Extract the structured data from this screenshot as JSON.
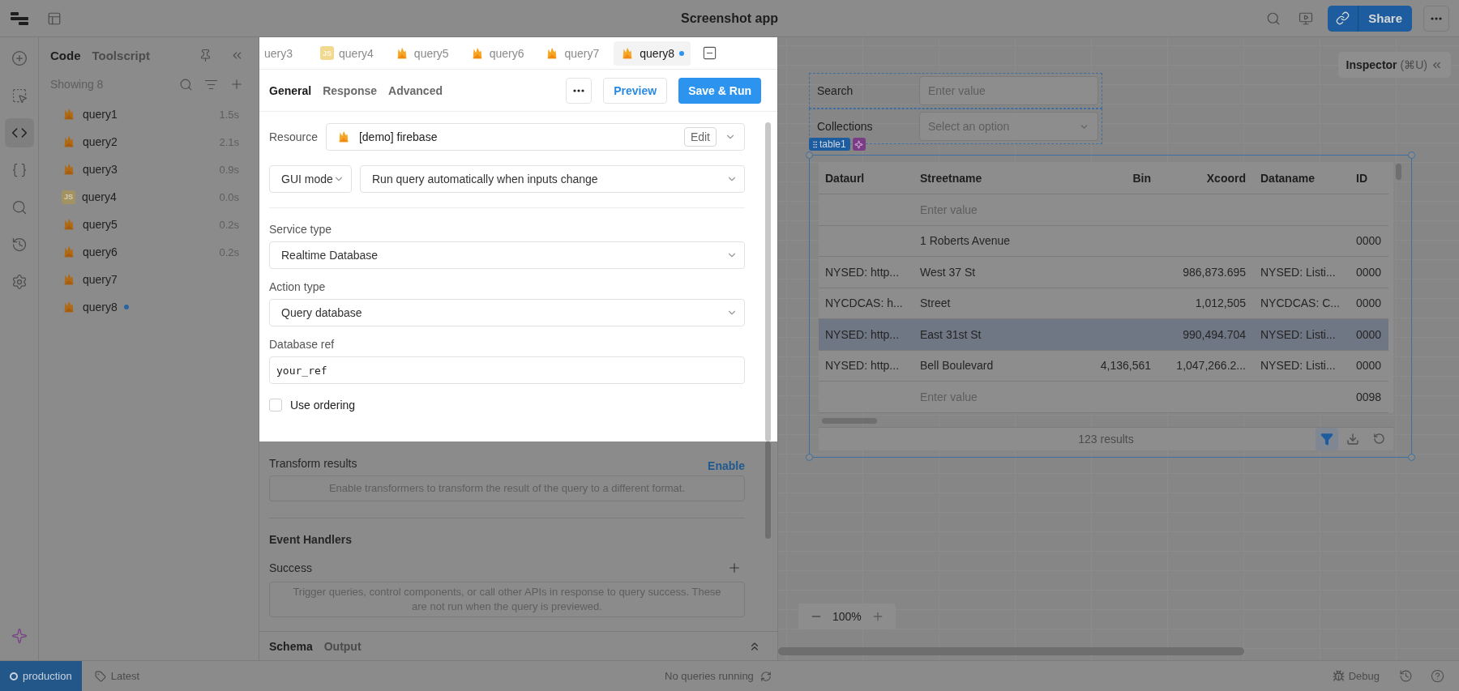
{
  "app": {
    "title": "Screenshot app",
    "share": "Share"
  },
  "sidebar": {
    "tabs": [
      {
        "label": "Code",
        "selected": true
      },
      {
        "label": "Toolscript",
        "selected": false
      }
    ],
    "count": "Showing 8",
    "queries": [
      {
        "name": "query1",
        "kind": "firebase",
        "time": "1.5s",
        "unsaved": false
      },
      {
        "name": "query2",
        "kind": "firebase",
        "time": "2.1s",
        "unsaved": false
      },
      {
        "name": "query3",
        "kind": "firebase",
        "time": "0.9s",
        "unsaved": false
      },
      {
        "name": "query4",
        "kind": "js",
        "badge": "JS",
        "time": "0.0s",
        "unsaved": false
      },
      {
        "name": "query5",
        "kind": "firebase",
        "time": "0.2s",
        "unsaved": false
      },
      {
        "name": "query6",
        "kind": "firebase",
        "time": "0.2s",
        "unsaved": false
      },
      {
        "name": "query7",
        "kind": "firebase",
        "unsaved": false
      },
      {
        "name": "query8",
        "kind": "firebase",
        "unsaved": true
      }
    ]
  },
  "editor": {
    "tabs": [
      {
        "label": "uery3",
        "kind": "cut",
        "selected": false,
        "unsaved": false
      },
      {
        "label": "query4",
        "kind": "js",
        "badge": "JS",
        "selected": false,
        "unsaved": false
      },
      {
        "label": "query5",
        "kind": "firebase",
        "selected": false,
        "unsaved": false
      },
      {
        "label": "query6",
        "kind": "firebase",
        "selected": false,
        "unsaved": false
      },
      {
        "label": "query7",
        "kind": "firebase",
        "selected": false,
        "unsaved": false
      },
      {
        "label": "query8",
        "kind": "firebase",
        "selected": true,
        "unsaved": true
      }
    ],
    "sections": [
      {
        "label": "General",
        "selected": true
      },
      {
        "label": "Response",
        "selected": false
      },
      {
        "label": "Advanced",
        "selected": false
      }
    ],
    "preview": "Preview",
    "save": "Save & Run",
    "resource": {
      "label": "Resource",
      "value": "[demo] firebase",
      "edit": "Edit"
    },
    "mode": "GUI mode",
    "trigger": "Run query automatically when inputs change",
    "fields": [
      {
        "label": "Service type",
        "kind": "select",
        "value": "Realtime Database"
      },
      {
        "label": "Action type",
        "kind": "select",
        "value": "Query database"
      },
      {
        "label": "Database ref",
        "kind": "code",
        "value": "your_ref"
      }
    ],
    "ordering": {
      "label": "Use ordering",
      "checked": false
    },
    "transform": {
      "title": "Transform results",
      "action": "Enable",
      "hint": "Enable transformers to transform the result of the query to a different format."
    },
    "events": {
      "title": "Event Handlers",
      "success": "Success",
      "hint": "Trigger queries, control components, or call other APIs in response to query success. These are not run when the query is previewed."
    },
    "bottom_tabs": [
      {
        "label": "Schema",
        "selected": true
      },
      {
        "label": "Output",
        "selected": false
      }
    ]
  },
  "canvas": {
    "inspector": "Inspector",
    "shortcut": "(⌘U)",
    "form": [
      {
        "label": "Search",
        "kind": "input",
        "placeholder": "Enter value"
      },
      {
        "label": "Collections",
        "kind": "select",
        "placeholder": "Select an option"
      }
    ],
    "table": {
      "name": "table1",
      "columns": [
        {
          "label": "Dataurl",
          "kind": "text"
        },
        {
          "label": "Streetname",
          "kind": "text"
        },
        {
          "label": "Bin",
          "kind": "number"
        },
        {
          "label": "Xcoord",
          "kind": "number"
        },
        {
          "label": "Dataname",
          "kind": "text"
        },
        {
          "label": "ID",
          "kind": "text"
        }
      ],
      "rows": [
        {
          "selected": false,
          "cells": [
            null,
            {
              "placeholder": "Enter value"
            },
            null,
            null,
            null,
            null
          ]
        },
        {
          "selected": false,
          "cells": [
            null,
            "1 Roberts Avenue",
            null,
            null,
            null,
            "0000"
          ]
        },
        {
          "selected": false,
          "cells": [
            "NYSED: http...",
            "West 37 St",
            null,
            "986,873.695",
            "NYSED: Listi...",
            "0000"
          ]
        },
        {
          "selected": false,
          "cells": [
            "NYCDCAS: h...",
            "Street",
            null,
            "1,012,505",
            "NYCDCAS: C...",
            "0000"
          ]
        },
        {
          "selected": true,
          "cells": [
            "NYSED: http...",
            "East 31st St",
            null,
            "990,494.704",
            "NYSED: Listi...",
            "0000"
          ]
        },
        {
          "selected": false,
          "cells": [
            "NYSED: http...",
            "Bell Boulevard",
            "4,136,561",
            "1,047,266.2...",
            "NYSED: Listi...",
            "0000"
          ]
        },
        {
          "selected": false,
          "cells": [
            null,
            {
              "placeholder": "Enter value"
            },
            null,
            null,
            null,
            "0098"
          ]
        }
      ],
      "footer": "123 results",
      "filter_on": true
    },
    "zoom": "100%"
  },
  "status_bar": {
    "environment": "production",
    "version": "Latest",
    "running": "No queries running",
    "debug": "Debug"
  }
}
